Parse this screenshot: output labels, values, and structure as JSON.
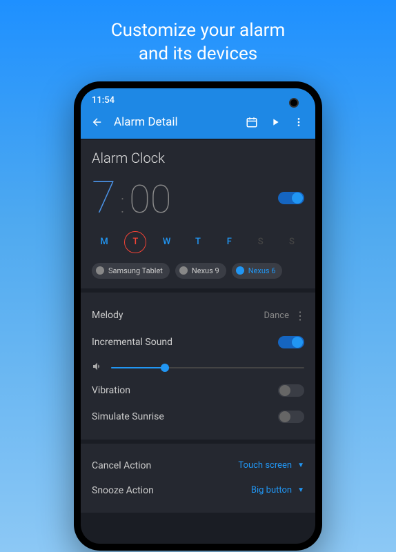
{
  "promo": {
    "line1": "Customize your alarm",
    "line2": "and its devices"
  },
  "status": {
    "time": "11:54"
  },
  "appbar": {
    "title": "Alarm Detail"
  },
  "alarm": {
    "title": "Alarm Clock",
    "hour": "7",
    "minute": "00",
    "enabled": true,
    "days": [
      {
        "label": "M",
        "active": true,
        "selected": false
      },
      {
        "label": "T",
        "active": true,
        "selected": true
      },
      {
        "label": "W",
        "active": true,
        "selected": false
      },
      {
        "label": "T",
        "active": true,
        "selected": false
      },
      {
        "label": "F",
        "active": true,
        "selected": false
      },
      {
        "label": "S",
        "active": false,
        "selected": false
      },
      {
        "label": "S",
        "active": false,
        "selected": false
      }
    ],
    "devices": [
      {
        "name": "Samsung Tablet",
        "active": false
      },
      {
        "name": "Nexus 9",
        "active": false
      },
      {
        "name": "Nexus 6",
        "active": true
      }
    ]
  },
  "settings": {
    "melody_label": "Melody",
    "melody_value": "Dance",
    "incremental_label": "Incremental Sound",
    "incremental_on": true,
    "volume_percent": 28,
    "vibration_label": "Vibration",
    "vibration_on": false,
    "sunrise_label": "Simulate Sunrise",
    "sunrise_on": false
  },
  "actions": {
    "cancel_label": "Cancel Action",
    "cancel_value": "Touch screen",
    "snooze_label": "Snooze Action",
    "snooze_value": "Big button"
  }
}
